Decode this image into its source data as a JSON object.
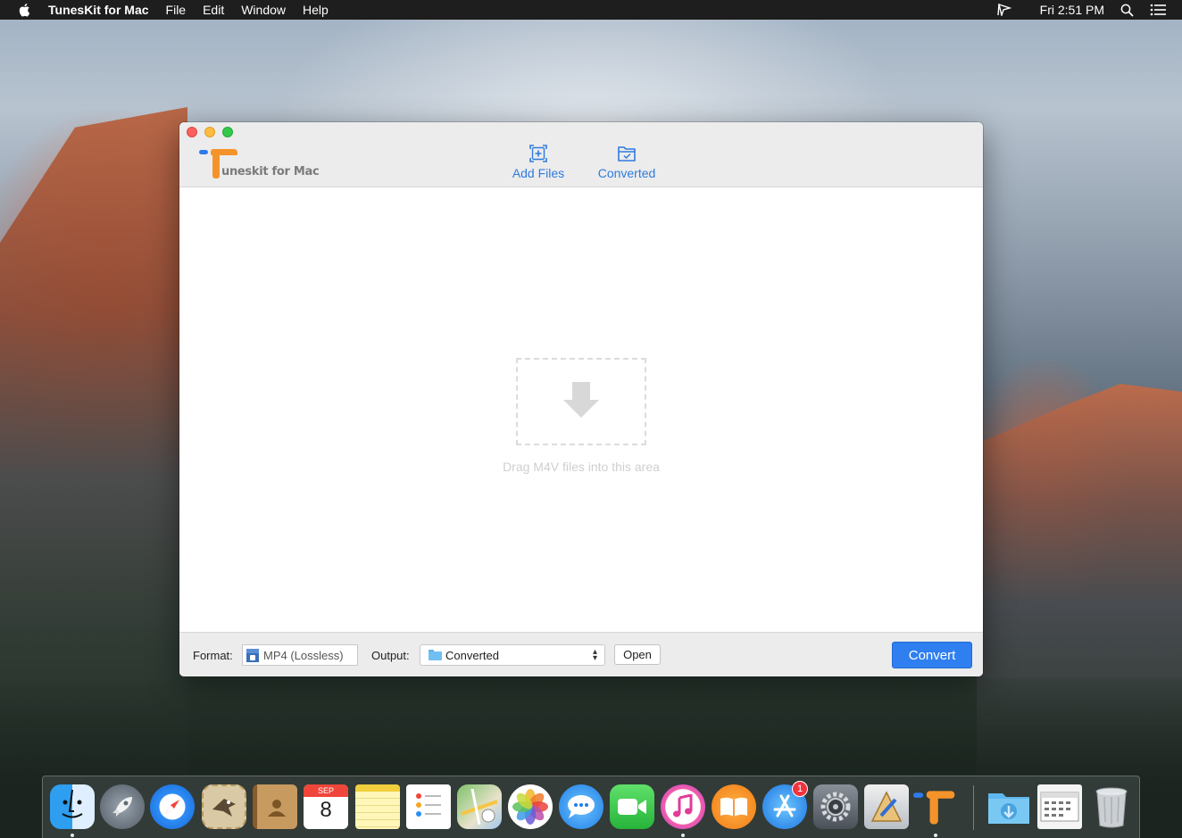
{
  "menubar": {
    "app_name": "TunesKit for Mac",
    "items": [
      "File",
      "Edit",
      "Window",
      "Help"
    ],
    "clock": "Fri 2:51 PM"
  },
  "window": {
    "logo_text": "uneskit for Mac",
    "toolbar": {
      "add_files_label": "Add Files",
      "converted_label": "Converted"
    },
    "dropzone": {
      "hint": "Drag M4V files into this area"
    },
    "bottom": {
      "format_label": "Format:",
      "format_value": "MP4 (Lossless)",
      "output_label": "Output:",
      "output_value": "Converted",
      "open_label": "Open",
      "convert_label": "Convert"
    }
  },
  "dock": {
    "items": [
      {
        "name": "Finder",
        "icon": "finder-icon"
      },
      {
        "name": "Launchpad",
        "icon": "rocket-icon"
      },
      {
        "name": "Safari",
        "icon": "compass-icon"
      },
      {
        "name": "Mail",
        "icon": "stamp-icon"
      },
      {
        "name": "Contacts",
        "icon": "address-book-icon"
      },
      {
        "name": "Calendar",
        "icon": "calendar-icon",
        "month": "SEP",
        "day": "8"
      },
      {
        "name": "Notes",
        "icon": "notepad-icon"
      },
      {
        "name": "Reminders",
        "icon": "checklist-icon"
      },
      {
        "name": "Maps",
        "icon": "map-icon"
      },
      {
        "name": "Photos",
        "icon": "flower-icon"
      },
      {
        "name": "Messages",
        "icon": "speech-bubble-icon"
      },
      {
        "name": "FaceTime",
        "icon": "video-camera-icon"
      },
      {
        "name": "iTunes",
        "icon": "music-note-icon"
      },
      {
        "name": "iBooks",
        "icon": "book-icon"
      },
      {
        "name": "App Store",
        "icon": "app-store-icon",
        "badge": "1"
      },
      {
        "name": "System Preferences",
        "icon": "gear-icon"
      },
      {
        "name": "Xcode",
        "icon": "hammer-icon"
      },
      {
        "name": "TunesKit",
        "icon": "tuneskit-icon"
      },
      {
        "name": "Downloads",
        "icon": "downloads-folder-icon"
      },
      {
        "name": "Window Manager",
        "icon": "grid-window-icon"
      },
      {
        "name": "Trash",
        "icon": "trash-icon"
      }
    ]
  },
  "colors": {
    "accent": "#2e7bde",
    "convert_button": "#2f7ff0"
  }
}
